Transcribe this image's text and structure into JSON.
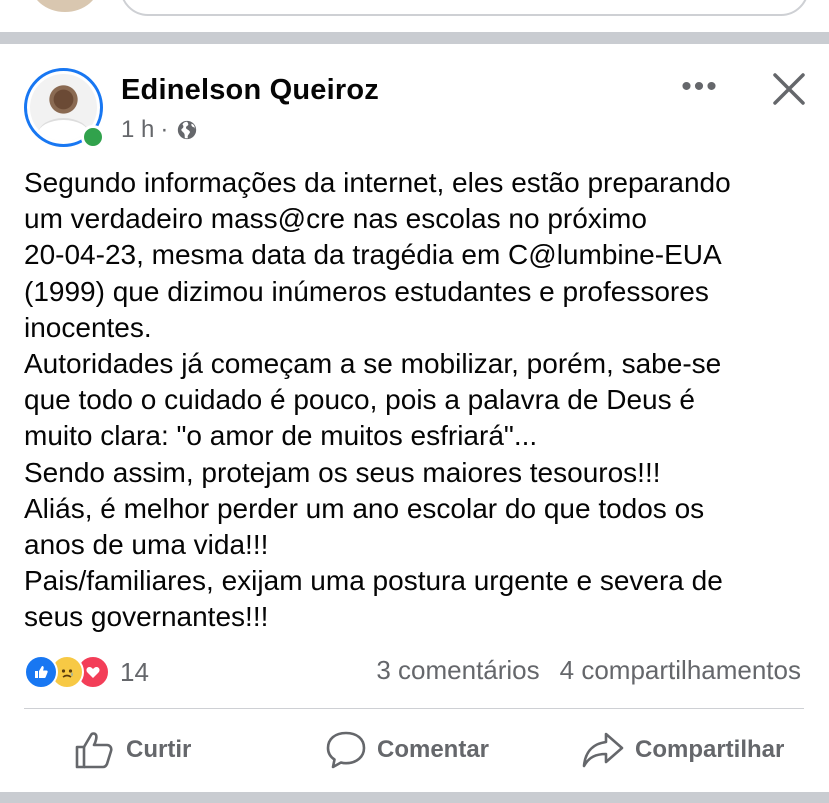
{
  "post": {
    "author": "Edinelson Queiroz",
    "time": "1 h",
    "separator": "·",
    "privacy_icon": "globe-icon",
    "text": "Segundo informações da internet, eles estão preparando\num verdadeiro mass@cre nas escolas no próximo\n20-04-23, mesma data da tragédia em C@lumbine-EUA\n(1999) que dizimou inúmeros estudantes e professores\ninocentes.\nAutoridades já começam a se mobilizar, porém, sabe-se\nque todo o cuidado é pouco, pois a palavra de Deus é\nmuito clara: \"o amor de muitos esfriará\"...\nSendo assim, protejam os seus maiores tesouros!!!\nAliás, é melhor perder um ano escolar do que todos os\nanos de uma vida!!!\nPais/familiares, exijam uma postura urgente e severa de\nseus governantes!!!",
    "reaction_icons": [
      "like-reaction",
      "sad-reaction",
      "love-reaction"
    ],
    "reaction_count": "14",
    "comments": "3 comentários",
    "shares": "4 compartilhamentos"
  },
  "actions": {
    "like": "Curtir",
    "comment": "Comentar",
    "share": "Compartilhar"
  },
  "colors": {
    "brand_blue": "#1877f2",
    "online_green": "#31a24c",
    "secondary_text": "#65676b",
    "separator": "#c9ccd1"
  }
}
